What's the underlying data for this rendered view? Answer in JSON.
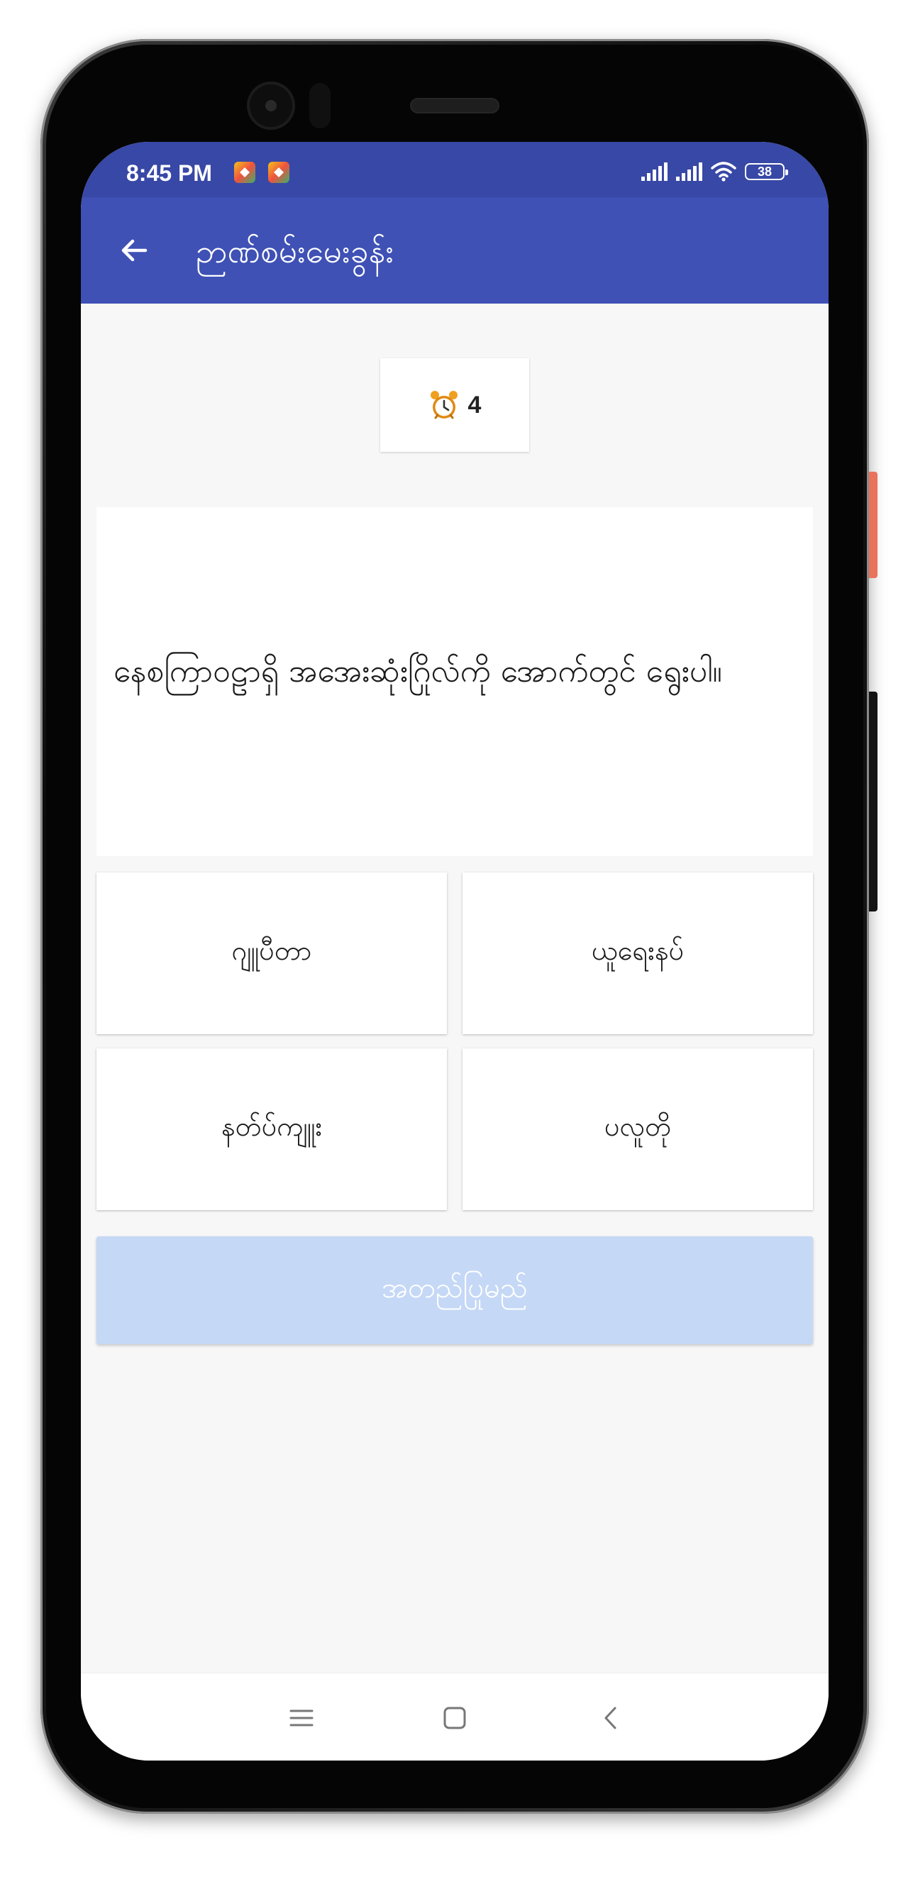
{
  "status_bar": {
    "time": "8:45 PM",
    "battery": "38",
    "icons": [
      "notification-app-icon",
      "notification-app-icon",
      "signal-icon",
      "signal-icon",
      "wifi-icon",
      "battery-icon"
    ]
  },
  "app_bar": {
    "title": "ဉာဏ်စမ်းမေးခွန်း",
    "back_icon": "arrow-left-icon"
  },
  "timer": {
    "icon": "alarm-clock-icon",
    "value": "4"
  },
  "question": {
    "text": "နေစကြာဝဠာရှိ အအေးဆုံးဂြိုလ်ကို အောက်တွင် ရွေးပါ။"
  },
  "options": [
    {
      "label": "ဂျူပီတာ"
    },
    {
      "label": "ယူရေးနပ်"
    },
    {
      "label": "နတ်ပ်ကျူး"
    },
    {
      "label": "ပလူတို"
    }
  ],
  "submit": {
    "label": "အတည်ပြုမည်",
    "enabled": false
  },
  "nav_bar": {
    "icons": [
      "menu-icon",
      "home-square-icon",
      "back-chevron-icon"
    ]
  },
  "colors": {
    "status_bar": "#3848a6",
    "app_bar": "#3f51b5",
    "background": "#f7f7f7",
    "submit_disabled": "#c5d8f6",
    "device_accent": "#e9735c"
  }
}
